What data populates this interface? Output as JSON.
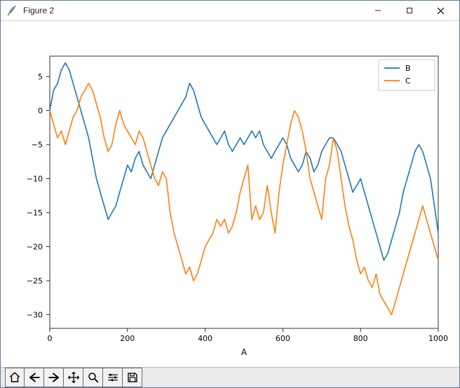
{
  "window": {
    "title": "Figure 2",
    "buttons": {
      "minimize": "Minimize",
      "maximize": "Maximize",
      "close": "Close"
    }
  },
  "toolbar": {
    "home": "Home",
    "back": "Back",
    "forward": "Forward",
    "pan": "Pan",
    "zoom": "Zoom",
    "configure": "Configure subplots",
    "save": "Save"
  },
  "chart_data": {
    "type": "line",
    "xlabel": "A",
    "ylabel": "",
    "xlim": [
      0,
      1000
    ],
    "ylim": [
      -32,
      8
    ],
    "xticks": [
      0,
      200,
      400,
      600,
      800,
      1000
    ],
    "yticks": [
      -30,
      -25,
      -20,
      -15,
      -10,
      -5,
      0,
      5
    ],
    "grid": false,
    "legend": {
      "position": "upper right",
      "entries": [
        "B",
        "C"
      ]
    },
    "series": [
      {
        "name": "B",
        "color": "#1f77b4",
        "x": [
          0,
          10,
          20,
          30,
          40,
          50,
          60,
          70,
          80,
          90,
          100,
          110,
          120,
          130,
          140,
          150,
          160,
          170,
          180,
          190,
          200,
          210,
          220,
          230,
          240,
          250,
          260,
          270,
          280,
          290,
          300,
          310,
          320,
          330,
          340,
          350,
          360,
          370,
          380,
          390,
          400,
          410,
          420,
          430,
          440,
          450,
          460,
          470,
          480,
          490,
          500,
          510,
          520,
          530,
          540,
          550,
          560,
          570,
          580,
          590,
          600,
          610,
          620,
          630,
          640,
          650,
          660,
          670,
          680,
          690,
          700,
          710,
          720,
          730,
          740,
          750,
          760,
          770,
          780,
          790,
          800,
          810,
          820,
          830,
          840,
          850,
          860,
          870,
          880,
          890,
          900,
          910,
          920,
          930,
          940,
          950,
          960,
          970,
          980,
          990,
          1000
        ],
        "values": [
          0,
          3,
          4,
          6,
          7,
          6,
          4,
          2,
          0,
          -2,
          -4,
          -7,
          -10,
          -12,
          -14,
          -16,
          -15,
          -14,
          -12,
          -10,
          -8,
          -9,
          -7,
          -6,
          -8,
          -9,
          -10,
          -8,
          -6,
          -4,
          -3,
          -2,
          -1,
          0,
          1,
          2,
          4,
          3,
          1,
          -1,
          -2,
          -3,
          -4,
          -5,
          -4,
          -3,
          -5,
          -6,
          -5,
          -4,
          -5,
          -4,
          -3,
          -4,
          -3,
          -5,
          -6,
          -7,
          -6,
          -5,
          -4,
          -5,
          -7,
          -8,
          -9,
          -8,
          -6,
          -7,
          -9,
          -8,
          -6,
          -5,
          -4,
          -4,
          -5,
          -6,
          -8,
          -10,
          -12,
          -11,
          -10,
          -12,
          -14,
          -16,
          -18,
          -20,
          -22,
          -21,
          -19,
          -17,
          -15,
          -12,
          -10,
          -8,
          -6,
          -5,
          -6,
          -8,
          -10,
          -14,
          -18
        ]
      },
      {
        "name": "C",
        "color": "#ff7f0e",
        "x": [
          0,
          10,
          20,
          30,
          40,
          50,
          60,
          70,
          80,
          90,
          100,
          110,
          120,
          130,
          140,
          150,
          160,
          170,
          180,
          190,
          200,
          210,
          220,
          230,
          240,
          250,
          260,
          270,
          280,
          290,
          300,
          310,
          320,
          330,
          340,
          350,
          360,
          370,
          380,
          390,
          400,
          410,
          420,
          430,
          440,
          450,
          460,
          470,
          480,
          490,
          500,
          510,
          520,
          530,
          540,
          550,
          560,
          570,
          580,
          590,
          600,
          610,
          620,
          630,
          640,
          650,
          660,
          670,
          680,
          690,
          700,
          710,
          720,
          730,
          740,
          750,
          760,
          770,
          780,
          790,
          800,
          810,
          820,
          830,
          840,
          850,
          860,
          870,
          880,
          890,
          900,
          910,
          920,
          930,
          940,
          950,
          960,
          970,
          980,
          990,
          1000
        ],
        "values": [
          0,
          -2,
          -4,
          -3,
          -5,
          -3,
          -1,
          0,
          2,
          3,
          4,
          3,
          1,
          -1,
          -4,
          -6,
          -5,
          -2,
          0,
          -2,
          -3,
          -4,
          -5,
          -3,
          -4,
          -6,
          -8,
          -10,
          -11,
          -9,
          -10,
          -15,
          -18,
          -20,
          -22,
          -24,
          -23,
          -25,
          -24,
          -22,
          -20,
          -19,
          -18,
          -16,
          -17,
          -16,
          -18,
          -17,
          -15,
          -12,
          -10,
          -8,
          -16,
          -14,
          -16,
          -15,
          -11,
          -15,
          -18,
          -12,
          -8,
          -5,
          -2,
          0,
          -1,
          -3,
          -6,
          -10,
          -12,
          -14,
          -16,
          -10,
          -8,
          -4,
          -6,
          -10,
          -14,
          -17,
          -19,
          -22,
          -24,
          -23,
          -25,
          -26,
          -24,
          -27,
          -28,
          -29,
          -30,
          -28,
          -26,
          -24,
          -22,
          -20,
          -18,
          -16,
          -14,
          -16,
          -18,
          -20,
          -22
        ]
      }
    ]
  }
}
